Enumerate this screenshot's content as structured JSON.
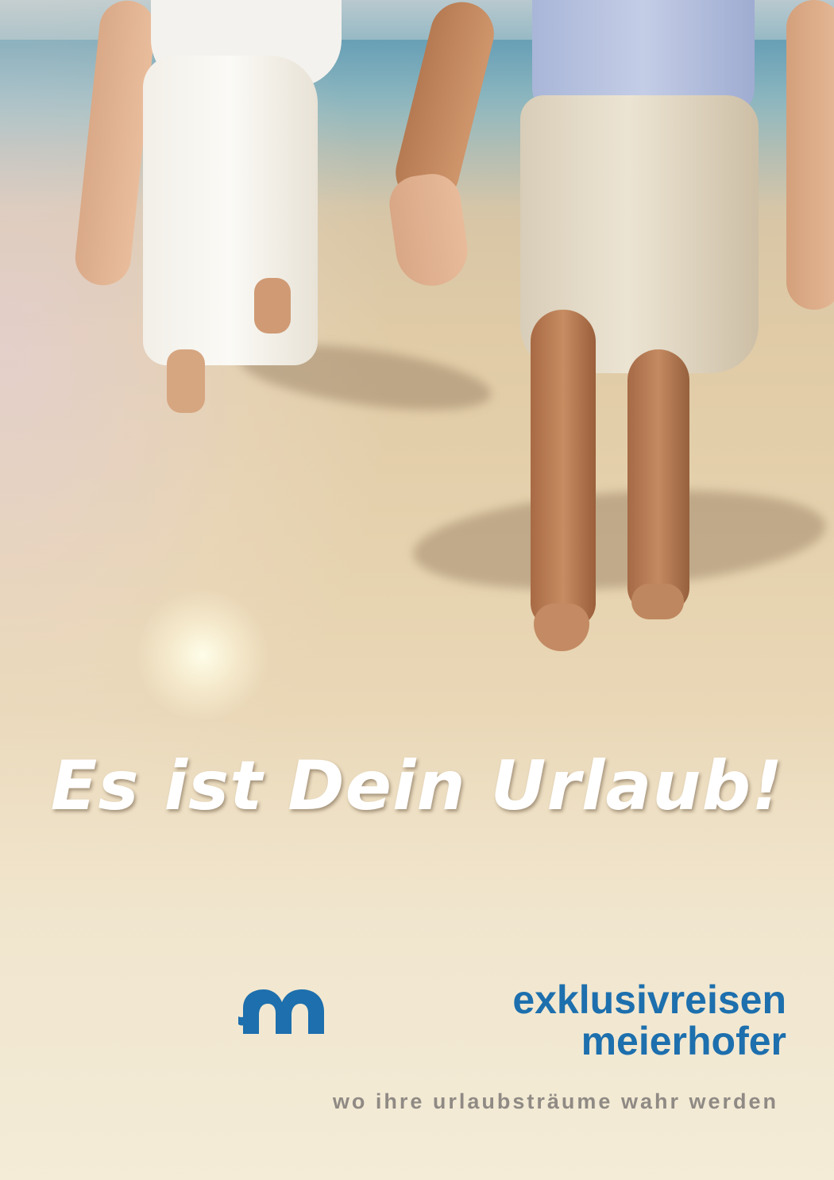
{
  "headline": "Es ist Dein Urlaub!",
  "brand": {
    "name_line1": "exklusivreisen",
    "name_line2": "meierhofer",
    "tagline": "wo ihre urlaubsträume wahr werden",
    "color": "#1d6fad",
    "logo_icon": "m-wave-logo-icon"
  },
  "photo": {
    "icon": "beach-photo"
  }
}
